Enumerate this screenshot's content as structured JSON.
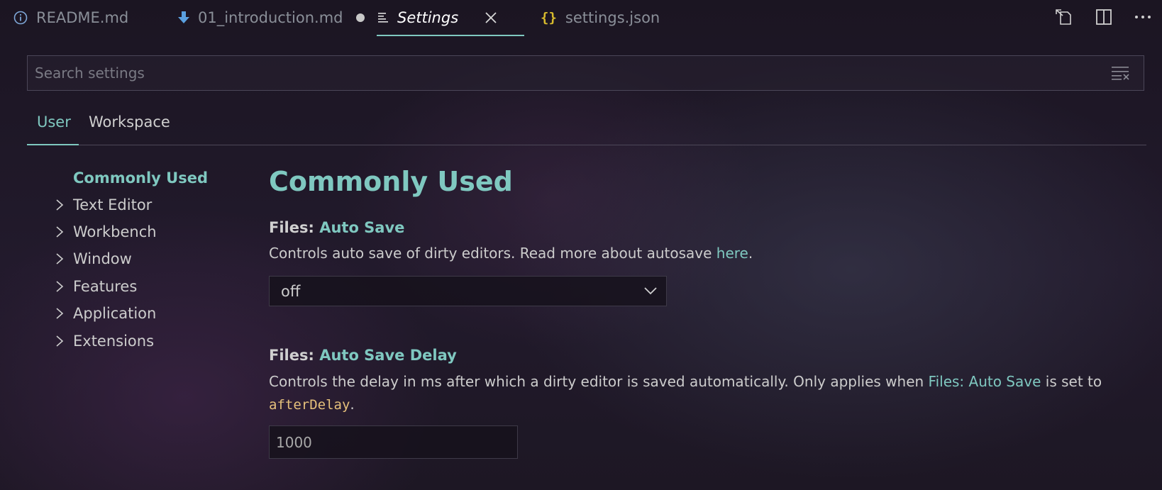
{
  "tabs": [
    {
      "label": "README.md",
      "icon": "info-icon"
    },
    {
      "label": "01_introduction.md",
      "icon": "download-arrow-icon",
      "dirty": true
    },
    {
      "label": "Settings",
      "icon": "settings-lines-icon",
      "active": true
    },
    {
      "label": "settings.json",
      "icon": "json-braces-icon",
      "icon_glyph": "{}"
    }
  ],
  "actions": {
    "open_json": "open-settings-json-icon",
    "split": "split-editor-icon",
    "more": "more-actions-icon"
  },
  "search": {
    "placeholder": "Search settings",
    "value": ""
  },
  "scopes": {
    "user": "User",
    "workspace": "Workspace",
    "active": "User"
  },
  "toc": {
    "active": "Commonly Used",
    "items": [
      "Text Editor",
      "Workbench",
      "Window",
      "Features",
      "Application",
      "Extensions"
    ]
  },
  "content": {
    "section_title": "Commonly Used",
    "settings": [
      {
        "category": "Files: ",
        "key": "Auto Save",
        "desc_before": "Controls auto save of dirty editors. Read more about autosave ",
        "link": "here",
        "desc_after": ".",
        "value": "off"
      },
      {
        "category": "Files: ",
        "key": "Auto Save Delay",
        "desc_before": "Controls the delay in ms after which a dirty editor is saved automatically. Only applies when ",
        "link": "Files: Auto Save",
        "desc_mid": " is set to",
        "code": "afterDelay",
        "desc_after": ".",
        "value": "1000"
      }
    ]
  },
  "colors": {
    "accent": "#7fc8c0",
    "code": "#e5c07b",
    "text": "#cccccc",
    "muted": "#8a8f98",
    "json_icon": "#d7ba2d"
  }
}
